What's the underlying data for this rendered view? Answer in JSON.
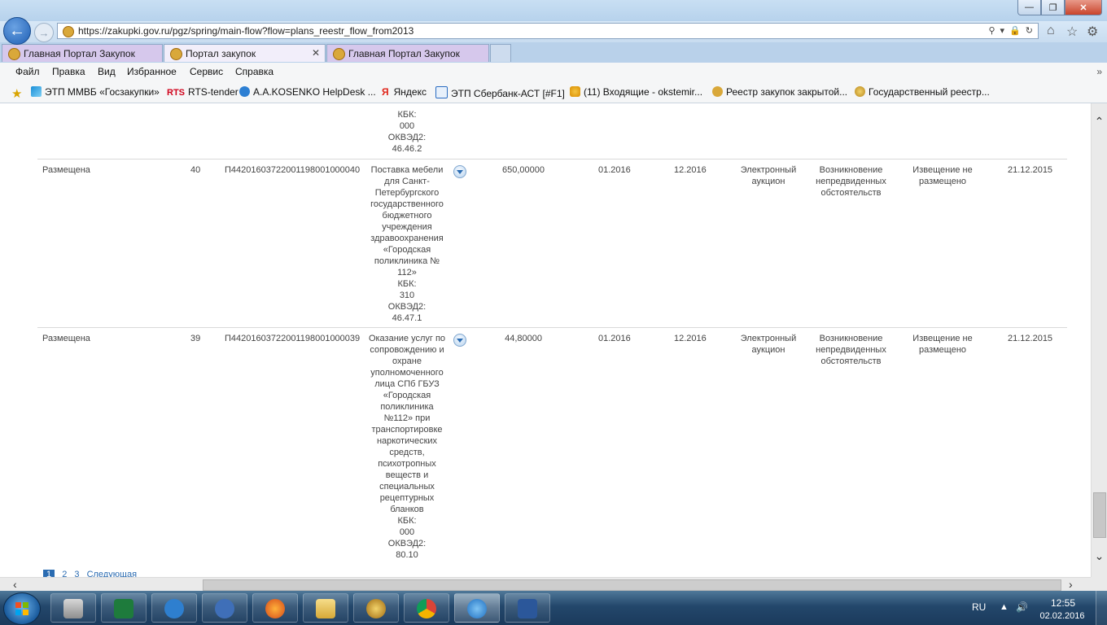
{
  "browser": {
    "url": "https://zakupki.gov.ru/pgz/spring/main-flow?flow=plans_reestr_flow_from2013",
    "tabs": [
      {
        "label": "Главная Портал Закупок"
      },
      {
        "label": "Портал закупок"
      },
      {
        "label": "Главная Портал Закупок"
      }
    ],
    "menu": [
      "Файл",
      "Правка",
      "Вид",
      "Избранное",
      "Сервис",
      "Справка"
    ],
    "favorites": [
      "ЭТП ММВБ «Госзакупки»",
      "RTS-tender",
      "А.А.KOSENKO  HelpDesk ...",
      "Яндекс",
      "ЭТП Сбербанк-АСТ [#F1]",
      "(11) Входящие - okstemir...",
      "Реестр закупок закрытой...",
      "Государственный реестр..."
    ],
    "rts_logo": "RTS",
    "yandex_logo": "Я"
  },
  "table": {
    "partial_top_lines": [
      "КБК:",
      "000",
      "ОКВЭД2:",
      "46.46.2"
    ],
    "rows": [
      {
        "status": "Размещена",
        "num": "40",
        "code": "П44201603722001198001000040",
        "desc_lines": [
          "Поставка мебели",
          "для Санкт-",
          "Петербургского",
          "государственного",
          "бюджетного",
          "учреждения",
          "здравоохранения",
          "«Городская",
          "поликлиника №",
          "112»",
          "КБК:",
          "310",
          "ОКВЭД2:",
          "46.47.1"
        ],
        "amount": "650,00000",
        "start": "01.2016",
        "end": "12.2016",
        "method": "Электронный аукцион",
        "reason": "Возникновение непредвиденных обстоятельств",
        "notice": "Извещение не размещено",
        "date": "21.12.2015"
      },
      {
        "status": "Размещена",
        "num": "39",
        "code": "П44201603722001198001000039",
        "desc_lines": [
          "Оказание услуг по",
          "сопровождению и",
          "охране",
          "уполномоченного",
          "лица СПб ГБУЗ",
          "«Городская",
          "поликлиника",
          "№112» при",
          "транспортировке",
          "наркотических",
          "средств,",
          "психотропных",
          "веществ и",
          "специальных",
          "рецептурных",
          "бланков",
          "КБК:",
          "000",
          "ОКВЭД2:",
          "80.10"
        ],
        "amount": "44,80000",
        "start": "01.2016",
        "end": "12.2016",
        "method": "Электронный аукцион",
        "reason": "Возникновение непредвиденных обстоятельств",
        "notice": "Извещение не размещено",
        "date": "21.12.2015"
      }
    ]
  },
  "pager": {
    "current": "1",
    "pages": [
      "2",
      "3"
    ],
    "next": "Следующая"
  },
  "taskbar": {
    "lang": "RU",
    "time": "12:55",
    "date": "02.02.2016"
  },
  "colors": {
    "accent": "#2b6cb2",
    "taskbar": "#23476b"
  }
}
